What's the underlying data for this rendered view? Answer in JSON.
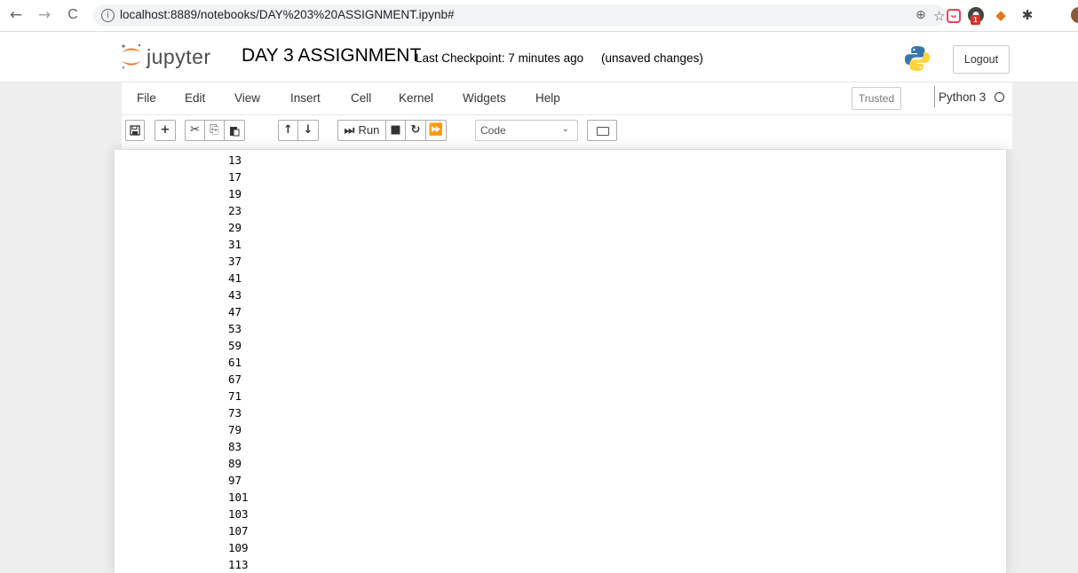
{
  "browser": {
    "url": "localhost:8889/notebooks/DAY%203%20ASSIGNMENT.ipynb#",
    "back_glyph": "←",
    "forward_glyph": "→",
    "reload_glyph": "C",
    "info_glyph": "i",
    "zoom_glyph": "⊕",
    "star_glyph": "☆",
    "ext_badge_count": "1"
  },
  "jupyter": {
    "logo_text": "jupyter",
    "notebook_name": "DAY 3 ASSIGNMENT",
    "checkpoint": "Last Checkpoint: 7 minutes ago",
    "unsaved": "(unsaved changes)",
    "logout_label": "Logout"
  },
  "menu": {
    "items": [
      "File",
      "Edit",
      "View",
      "Insert",
      "Cell",
      "Kernel",
      "Widgets",
      "Help"
    ],
    "trusted_label": "Trusted",
    "kernel_name": "Python 3"
  },
  "toolbar": {
    "run_label": "Run",
    "cell_type": "Code",
    "icons": [
      "save-icon",
      "plus-icon",
      "cut-icon",
      "copy-icon",
      "paste-icon",
      "arrow-up-icon",
      "arrow-down-icon",
      "run-icon",
      "stop-icon",
      "restart-icon",
      "fast-forward-icon",
      "keyboard-icon"
    ]
  },
  "output": {
    "lines": [
      "13",
      "17",
      "19",
      "23",
      "29",
      "31",
      "37",
      "41",
      "43",
      "47",
      "53",
      "59",
      "61",
      "67",
      "71",
      "73",
      "79",
      "83",
      "89",
      "97",
      "101",
      "103",
      "107",
      "109",
      "113"
    ]
  },
  "colors": {
    "jupyter_orange": "#f37726",
    "python_blue": "#3776ab",
    "python_yellow": "#ffd43b"
  }
}
